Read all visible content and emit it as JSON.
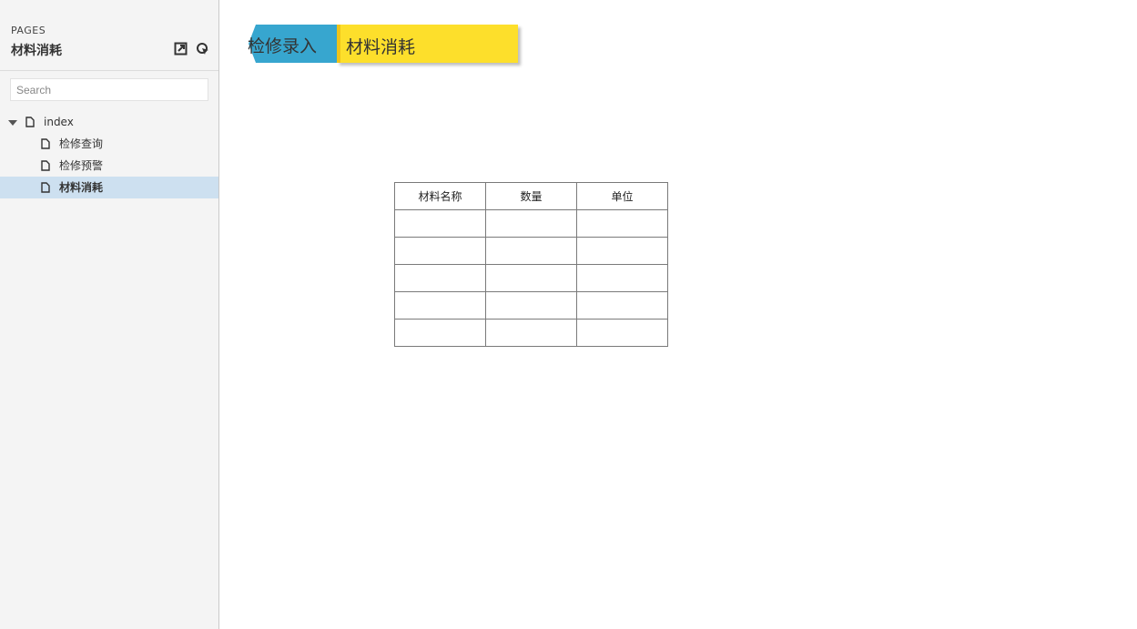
{
  "sidebar": {
    "pages_label": "PAGES",
    "current_page": "材料消耗",
    "search": {
      "placeholder": "Search",
      "value": ""
    },
    "tree": [
      {
        "label": "index",
        "level": 0,
        "expanded": true,
        "selected": false
      },
      {
        "label": "检修查询",
        "level": 1,
        "selected": false
      },
      {
        "label": "检修预警",
        "level": 1,
        "selected": false
      },
      {
        "label": "材料消耗",
        "level": 1,
        "selected": true
      }
    ]
  },
  "main": {
    "tag_primary": "检修录入",
    "tag_secondary": "材料消耗",
    "table": {
      "headers": [
        "材料名称",
        "数量",
        "单位"
      ],
      "rows": [
        [
          "",
          "",
          ""
        ],
        [
          "",
          "",
          ""
        ],
        [
          "",
          "",
          ""
        ],
        [
          "",
          "",
          ""
        ],
        [
          "",
          "",
          ""
        ]
      ]
    }
  },
  "colors": {
    "sidebar_bg": "#f4f4f4",
    "selected_row": "#cde0f0",
    "tag_blue": "#37a6cf",
    "tag_yellow": "#fddf2b"
  },
  "icons": [
    "export-icon",
    "locate-icon",
    "expand-caret-icon",
    "page-icon"
  ]
}
